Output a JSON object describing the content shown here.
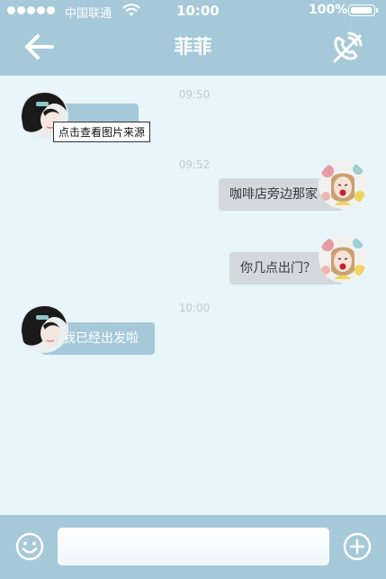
{
  "status_bar": {
    "carrier": "中国联通",
    "time": "10:00",
    "battery_percent": "100%",
    "signal_bars": 5,
    "battery_level": 1.0
  },
  "header": {
    "title": "菲菲",
    "back_icon": "arrow-left-icon",
    "call_icon": "phone-call-icon"
  },
  "messages": [
    {
      "time": "09:50",
      "side": "left",
      "text": "...",
      "tooltip": "点击查看图片来源"
    },
    {
      "time": "09:52",
      "side": "right",
      "text": "咖啡店旁边那家"
    },
    {
      "time": "",
      "side": "right",
      "text": "你几点出门？"
    },
    {
      "time": "10:00",
      "side": "left",
      "text": "我已经出发啦"
    }
  ],
  "input_bar": {
    "emoji_icon": "smiley-icon",
    "placeholder": "",
    "value": "",
    "add_icon": "plus-circle-icon"
  },
  "colors": {
    "accent": "#a6c9d9",
    "background": "#e8f5fa",
    "right_bubble": "#d2d8dc"
  }
}
